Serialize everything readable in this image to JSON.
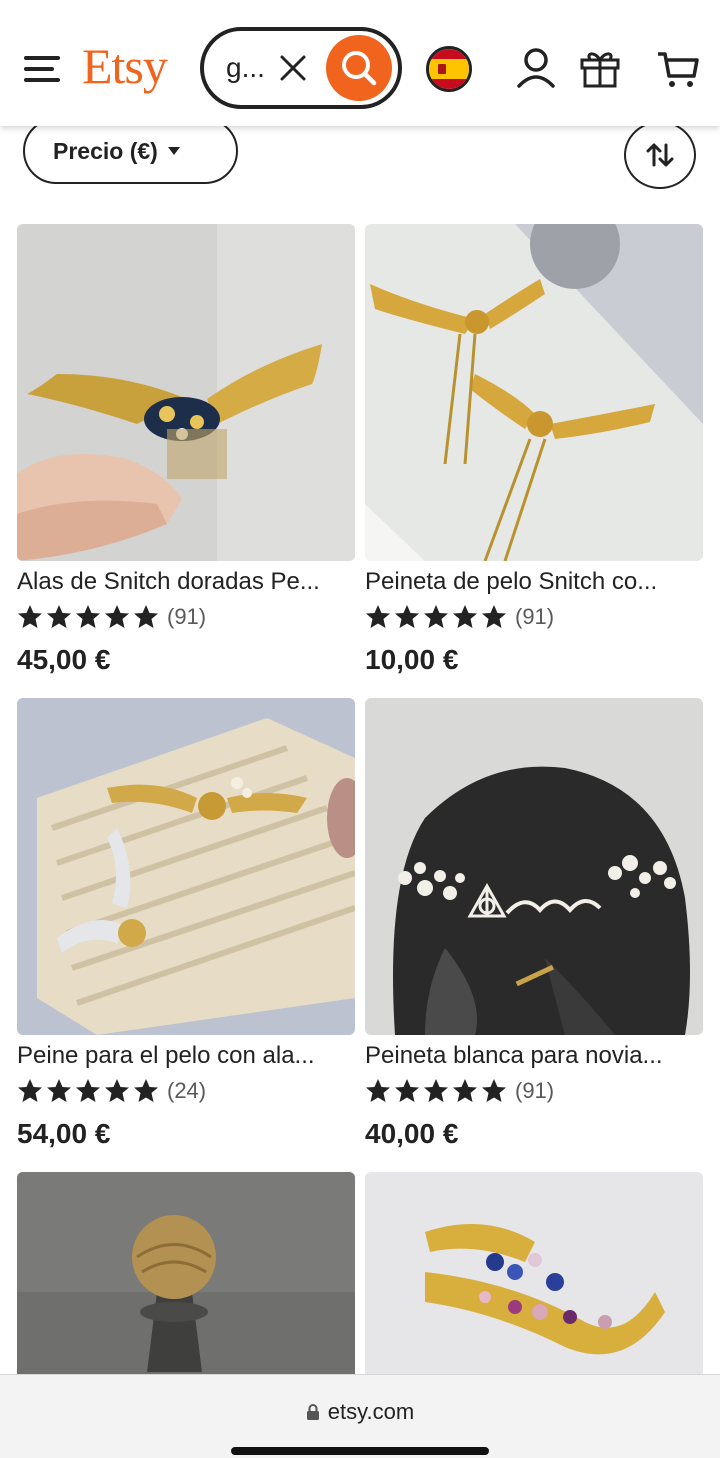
{
  "header": {
    "logo": "Etsy",
    "search": {
      "value": "g...",
      "placeholder": ""
    },
    "colors": {
      "brand": "#f1641e"
    }
  },
  "filters": {
    "price_label": "Precio (€)"
  },
  "products": [
    {
      "title": "Alas de Snitch doradas Pe...",
      "reviews": "(91)",
      "price": "45,00 €",
      "stars": 5
    },
    {
      "title": "Peineta de pelo Snitch co...",
      "reviews": "(91)",
      "price": "10,00 €",
      "stars": 5
    },
    {
      "title": "Peine para el pelo con ala...",
      "reviews": "(24)",
      "price": "54,00 €",
      "stars": 5
    },
    {
      "title": "Peineta blanca para novia...",
      "reviews": "(91)",
      "price": "40,00 €",
      "stars": 5
    },
    {
      "title": "",
      "reviews": "",
      "price": "",
      "stars": 0
    },
    {
      "title": "",
      "reviews": "",
      "price": "",
      "stars": 0
    }
  ],
  "browser": {
    "url": "etsy.com"
  }
}
